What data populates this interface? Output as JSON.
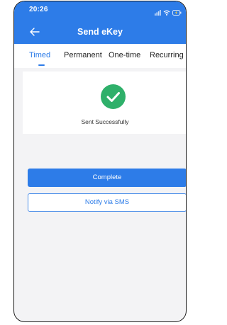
{
  "status_bar": {
    "time": "20:26",
    "icons": [
      "signal-icon",
      "wifi-icon",
      "battery-icon"
    ]
  },
  "nav": {
    "back_icon": "arrow-left-icon",
    "title": "Send eKey"
  },
  "tabs": [
    {
      "label": "Timed",
      "active": true
    },
    {
      "label": "Permanent",
      "active": false
    },
    {
      "label": "One-time",
      "active": false
    },
    {
      "label": "Recurring",
      "active": false
    }
  ],
  "result": {
    "icon": "checkmark-icon",
    "message": "Sent Successfully"
  },
  "actions": {
    "complete_label": "Complete",
    "sms_label": "Notify via SMS"
  },
  "colors": {
    "primary": "#2d7ce8",
    "success": "#2fb06a",
    "background": "#f3f3f5"
  }
}
